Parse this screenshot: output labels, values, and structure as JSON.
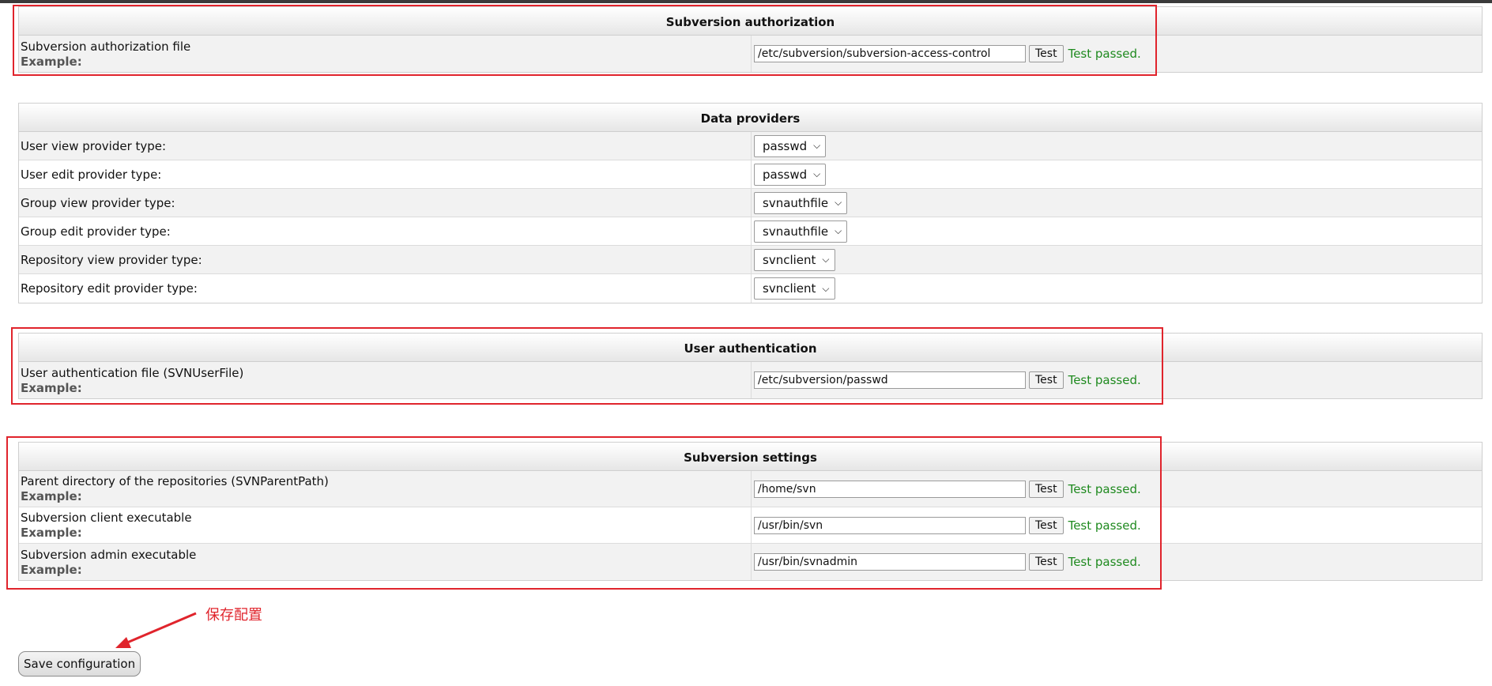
{
  "sections": {
    "svn_authz": {
      "title": "Subversion authorization",
      "example_label": "Example:",
      "test_label": "Test",
      "rows": [
        {
          "label": "Subversion authorization file",
          "value": "/etc/subversion/subversion-access-control",
          "status": "Test passed."
        }
      ]
    },
    "data_providers": {
      "title": "Data providers",
      "rows": [
        {
          "label": "User view provider type:",
          "selected": "passwd"
        },
        {
          "label": "User edit provider type:",
          "selected": "passwd"
        },
        {
          "label": "Group view provider type:",
          "selected": "svnauthfile"
        },
        {
          "label": "Group edit provider type:",
          "selected": "svnauthfile"
        },
        {
          "label": "Repository view provider type:",
          "selected": "svnclient"
        },
        {
          "label": "Repository edit provider type:",
          "selected": "svnclient"
        }
      ]
    },
    "user_auth": {
      "title": "User authentication",
      "example_label": "Example:",
      "test_label": "Test",
      "rows": [
        {
          "label": "User authentication file (SVNUserFile)",
          "value": "/etc/subversion/passwd",
          "status": "Test passed."
        }
      ]
    },
    "svn_settings": {
      "title": "Subversion settings",
      "example_label": "Example:",
      "test_label": "Test",
      "rows": [
        {
          "label": "Parent directory of the repositories (SVNParentPath)",
          "value": "/home/svn",
          "status": "Test passed."
        },
        {
          "label": "Subversion client executable",
          "value": "/usr/bin/svn",
          "status": "Test passed."
        },
        {
          "label": "Subversion admin executable",
          "value": "/usr/bin/svnadmin",
          "status": "Test passed."
        }
      ]
    }
  },
  "annotation": {
    "text": "保存配置",
    "color": "#e0242c"
  },
  "save_button": {
    "label": "Save configuration"
  },
  "colors": {
    "status_ok": "#1f8a1f",
    "annotation_red": "#e0242c"
  }
}
